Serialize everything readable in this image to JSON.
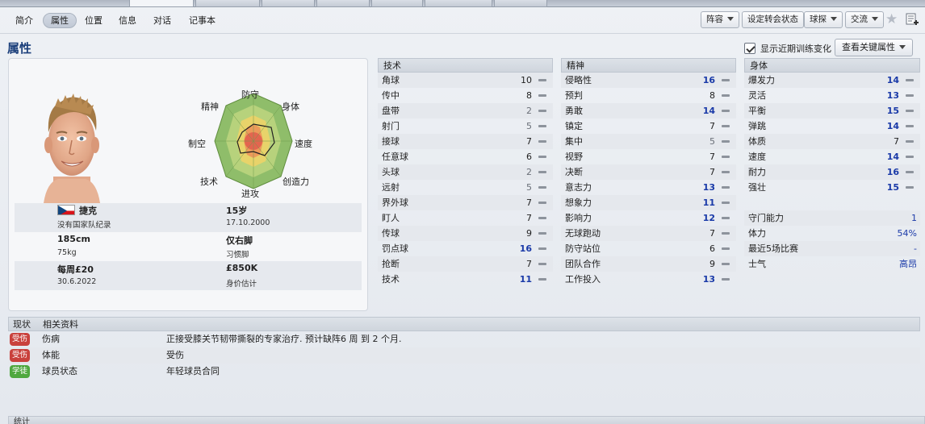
{
  "subnav": {
    "items": [
      "简介",
      "属性",
      "位置",
      "信息",
      "对话",
      "记事本"
    ],
    "active": 1
  },
  "toolbar": {
    "lineup": "阵容",
    "transfer_status": "设定转会状态",
    "scout": "球探",
    "interact": "交流"
  },
  "page": {
    "title": "属性",
    "show_training_label": "显示近期训练变化",
    "key_attr_button": "查看关键属性"
  },
  "radar": {
    "labels": {
      "defending": "防守",
      "physical": "身体",
      "speed": "速度",
      "creativity": "创造力",
      "attacking": "进攻",
      "technique": "技术",
      "aerial": "制空",
      "mental": "精神"
    }
  },
  "profile": {
    "nationality": "捷克",
    "intl": "没有国家队纪录",
    "age": "15岁",
    "dob": "17.10.2000",
    "height": "185cm",
    "weight": "75kg",
    "foot": "仅右脚",
    "foot_label": "习惯脚",
    "wage": "每周£20",
    "contract_end": "30.6.2022",
    "value": "£850K",
    "value_label": "身价估计"
  },
  "technical": {
    "header": "技术",
    "rows": [
      {
        "name": "角球",
        "value": "10"
      },
      {
        "name": "传中",
        "value": "8"
      },
      {
        "name": "盘带",
        "value": "2"
      },
      {
        "name": "射门",
        "value": "5"
      },
      {
        "name": "接球",
        "value": "7"
      },
      {
        "name": "任意球",
        "value": "6"
      },
      {
        "name": "头球",
        "value": "2"
      },
      {
        "name": "远射",
        "value": "5"
      },
      {
        "name": "界外球",
        "value": "7"
      },
      {
        "name": "盯人",
        "value": "7"
      },
      {
        "name": "传球",
        "value": "9"
      },
      {
        "name": "罚点球",
        "value": "16"
      },
      {
        "name": "抢断",
        "value": "7"
      },
      {
        "name": "技术",
        "value": "11"
      }
    ]
  },
  "mental": {
    "header": "精神",
    "rows": [
      {
        "name": "侵略性",
        "value": "16"
      },
      {
        "name": "预判",
        "value": "8"
      },
      {
        "name": "勇敢",
        "value": "14"
      },
      {
        "name": "镇定",
        "value": "7"
      },
      {
        "name": "集中",
        "value": "5"
      },
      {
        "name": "视野",
        "value": "7"
      },
      {
        "name": "决断",
        "value": "7"
      },
      {
        "name": "意志力",
        "value": "13"
      },
      {
        "name": "想象力",
        "value": "11"
      },
      {
        "name": "影响力",
        "value": "12"
      },
      {
        "name": "无球跑动",
        "value": "7"
      },
      {
        "name": "防守站位",
        "value": "6"
      },
      {
        "name": "团队合作",
        "value": "9"
      },
      {
        "name": "工作投入",
        "value": "13"
      }
    ]
  },
  "physical": {
    "header": "身体",
    "rows": [
      {
        "name": "爆发力",
        "value": "14"
      },
      {
        "name": "灵活",
        "value": "13"
      },
      {
        "name": "平衡",
        "value": "15"
      },
      {
        "name": "弹跳",
        "value": "14"
      },
      {
        "name": "体质",
        "value": "7"
      },
      {
        "name": "速度",
        "value": "14"
      },
      {
        "name": "耐力",
        "value": "16"
      },
      {
        "name": "强壮",
        "value": "15"
      }
    ],
    "extra": [
      {
        "name": "守门能力",
        "value": "1"
      },
      {
        "name": "体力",
        "value": "54%"
      },
      {
        "name": "最近5场比赛",
        "value": "-"
      },
      {
        "name": "士气",
        "value": "高昂"
      }
    ]
  },
  "status": {
    "col1": "现状",
    "col2": "相关资料",
    "rows": [
      {
        "badge": "受伤",
        "badge_color": "#c9413c",
        "label": "伤病",
        "detail": "正接受膝关节韧带撕裂的专家治疗. 预计缺阵6 周 到 2 个月."
      },
      {
        "badge": "受伤",
        "badge_color": "#c9413c",
        "label": "体能",
        "detail": "受伤"
      },
      {
        "badge": "学徒",
        "badge_color": "#4fa83f",
        "label": "球员状态",
        "detail": "年轻球员合同"
      }
    ]
  },
  "stats_strip": {
    "label": "统计"
  }
}
